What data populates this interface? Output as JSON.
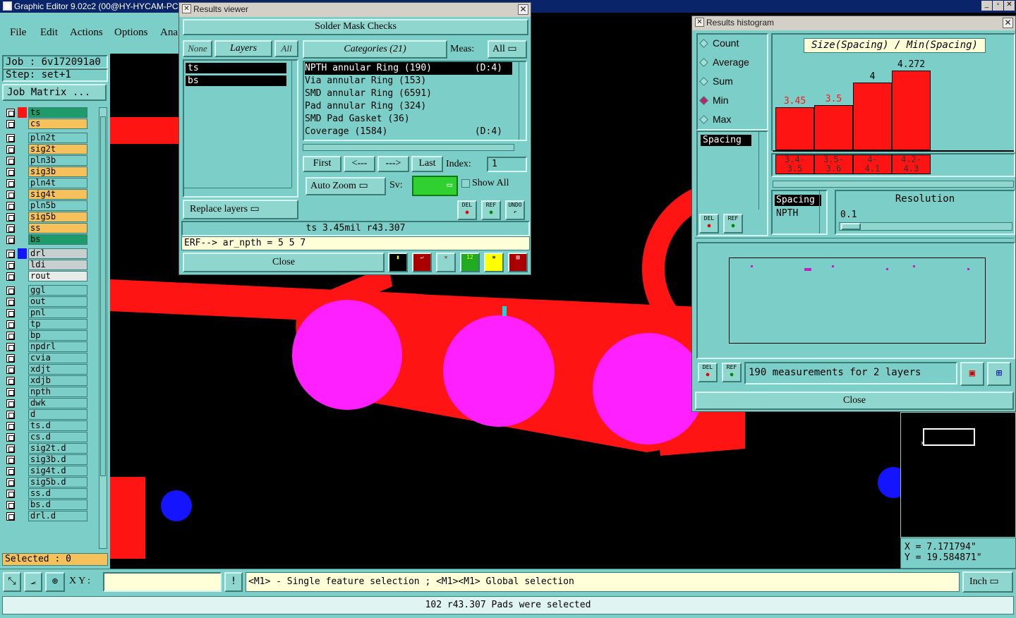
{
  "app": {
    "title": "Graphic Editor 9.02c2 (00@HY-HYCAM-PC"
  },
  "menu": [
    "File",
    "Edit",
    "Actions",
    "Options",
    "Ana"
  ],
  "job": {
    "job_label": "Job : 6v172091a0",
    "step_label": "Step: set+1",
    "matrix_button": "Job Matrix ..."
  },
  "layers": [
    {
      "name": "ts",
      "style": "gr"
    },
    {
      "name": "cs",
      "style": "or"
    },
    {
      "name": "pln2t",
      "style": ""
    },
    {
      "name": "sig2t",
      "style": "or"
    },
    {
      "name": "pln3b",
      "style": ""
    },
    {
      "name": "sig3b",
      "style": "or"
    },
    {
      "name": "pln4t",
      "style": ""
    },
    {
      "name": "sig4t",
      "style": "or"
    },
    {
      "name": "pln5b",
      "style": ""
    },
    {
      "name": "sig5b",
      "style": "or"
    },
    {
      "name": "ss",
      "style": "or"
    },
    {
      "name": "bs",
      "style": "gr"
    },
    {
      "name": "drl",
      "style": "gy"
    },
    {
      "name": "ldi",
      "style": "gy"
    },
    {
      "name": "rout",
      "style": "wt"
    },
    {
      "name": "ggl",
      "style": ""
    },
    {
      "name": "out",
      "style": ""
    },
    {
      "name": "pnl",
      "style": ""
    },
    {
      "name": "tp",
      "style": ""
    },
    {
      "name": "bp",
      "style": ""
    },
    {
      "name": "npdrl",
      "style": ""
    },
    {
      "name": "cvia",
      "style": ""
    },
    {
      "name": "xdjt",
      "style": ""
    },
    {
      "name": "xdjb",
      "style": ""
    },
    {
      "name": "npth",
      "style": ""
    },
    {
      "name": "dwk",
      "style": ""
    },
    {
      "name": "d",
      "style": ""
    },
    {
      "name": "ts.d",
      "style": ""
    },
    {
      "name": "cs.d",
      "style": ""
    },
    {
      "name": "sig2t.d",
      "style": ""
    },
    {
      "name": "sig3b.d",
      "style": ""
    },
    {
      "name": "sig4t.d",
      "style": ""
    },
    {
      "name": "sig5b.d",
      "style": ""
    },
    {
      "name": "ss.d",
      "style": ""
    },
    {
      "name": "bs.d",
      "style": ""
    },
    {
      "name": "drl.d",
      "style": ""
    }
  ],
  "selected_count": "Selected : 0",
  "results_viewer": {
    "title": "Results viewer",
    "header": "Solder Mask Checks",
    "btn_none": "None",
    "btn_layers": "Layers",
    "btn_all": "All",
    "layer_items": [
      "ts",
      "bs"
    ],
    "categories_label": "Categories (21)",
    "meas_label": "Meas:",
    "meas_value": "All",
    "categories": [
      {
        "name": "NPTH annular Ring (190)",
        "tag": "(D:4)"
      },
      {
        "name": "Via annular Ring (153)",
        "tag": ""
      },
      {
        "name": "SMD annular Ring (6591)",
        "tag": ""
      },
      {
        "name": "Pad annular Ring (324)",
        "tag": ""
      },
      {
        "name": "SMD Pad Gasket (36)",
        "tag": ""
      },
      {
        "name": "Coverage (1584)",
        "tag": "(D:4)"
      }
    ],
    "nav": {
      "first": "First",
      "prev": "<---",
      "next": "--->",
      "last": "Last",
      "index_label": "Index:",
      "index_value": "1"
    },
    "auto_zoom": "Auto Zoom",
    "sv_label": "Sv:",
    "show_all": "Show All",
    "replace_layers": "Replace layers",
    "icons": {
      "del": "DEL",
      "ref": "REF",
      "undo": "UNDO"
    },
    "status": "ts 3.45mil  r43.307",
    "erf": "ERF--> ar_npth = 5 5 7",
    "close": "Close"
  },
  "histogram": {
    "title": "Results histogram",
    "modes": [
      "Count",
      "Average",
      "Sum",
      "Min",
      "Max"
    ],
    "selected_mode": "Min",
    "measure_list": [
      "Spacing"
    ],
    "chart_title": "Size(Spacing) / Min(Spacing)",
    "resolution_label": "Resolution",
    "resolution_value": "0.1",
    "list2": [
      "Spacing",
      "NPTH"
    ],
    "summary": "190 measurements for 2 layers",
    "close": "Close",
    "icons": {
      "del": "DEL",
      "ref": "REF"
    }
  },
  "chart_data": {
    "type": "bar",
    "title": "Size(Spacing) / Min(Spacing)",
    "categories": [
      "3.4-3.5",
      "3.5-3.6",
      "4-4.1",
      "4.2-4.3"
    ],
    "category_labels": [
      [
        "3.4-",
        "3.5"
      ],
      [
        "3.5-",
        "3.6"
      ],
      [
        "4-",
        "4.1"
      ],
      [
        "4.2-",
        "4.3"
      ]
    ],
    "values": [
      3.45,
      3.5,
      4,
      4.272
    ],
    "value_labels": [
      "3.45",
      "3.5",
      "4",
      "4.272"
    ],
    "ylim": [
      0,
      4.5
    ],
    "bar_color": "#ff1414"
  },
  "coords": {
    "x": "X = 7.171794\"",
    "y": "Y = 19.584871\""
  },
  "bottom": {
    "xy_label": "X Y :",
    "xy_value": "",
    "hint": "<M1> - Single feature selection ; <M1><M1> Global selection",
    "units": "Inch",
    "status": "102 r43.307 Pads were selected"
  },
  "colors": {
    "panel": "#7ccfc8",
    "copper": "#ff1414",
    "pad": "#ff20ff",
    "drill": "#1414ff",
    "highlight": "#22d0d8"
  }
}
